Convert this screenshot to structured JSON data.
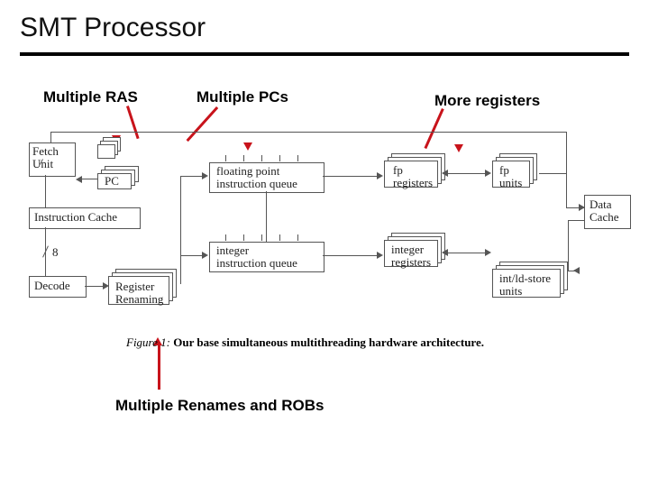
{
  "title": "SMT Processor",
  "labels": {
    "ras": "Multiple RAS",
    "pcs": "Multiple PCs",
    "regs": "More registers",
    "renames": "Multiple Renames and ROBs"
  },
  "blocks": {
    "fetch": "Fetch\nUnit",
    "pc": "PC",
    "icache": "Instruction Cache",
    "decode": "Decode",
    "rename": "Register\nRenaming",
    "fpq": "floating point\ninstruction queue",
    "intq": "integer\ninstruction queue",
    "fpreg": "fp\nregisters",
    "intreg": "integer\nregisters",
    "fpunits": "fp\nunits",
    "ldst": "int/ld-store\nunits",
    "dcache": "Data\nCache",
    "buswidth": "8"
  },
  "caption": {
    "lead": "Figure 1:",
    "text": "Our base simultaneous multithreading hardware architecture."
  }
}
